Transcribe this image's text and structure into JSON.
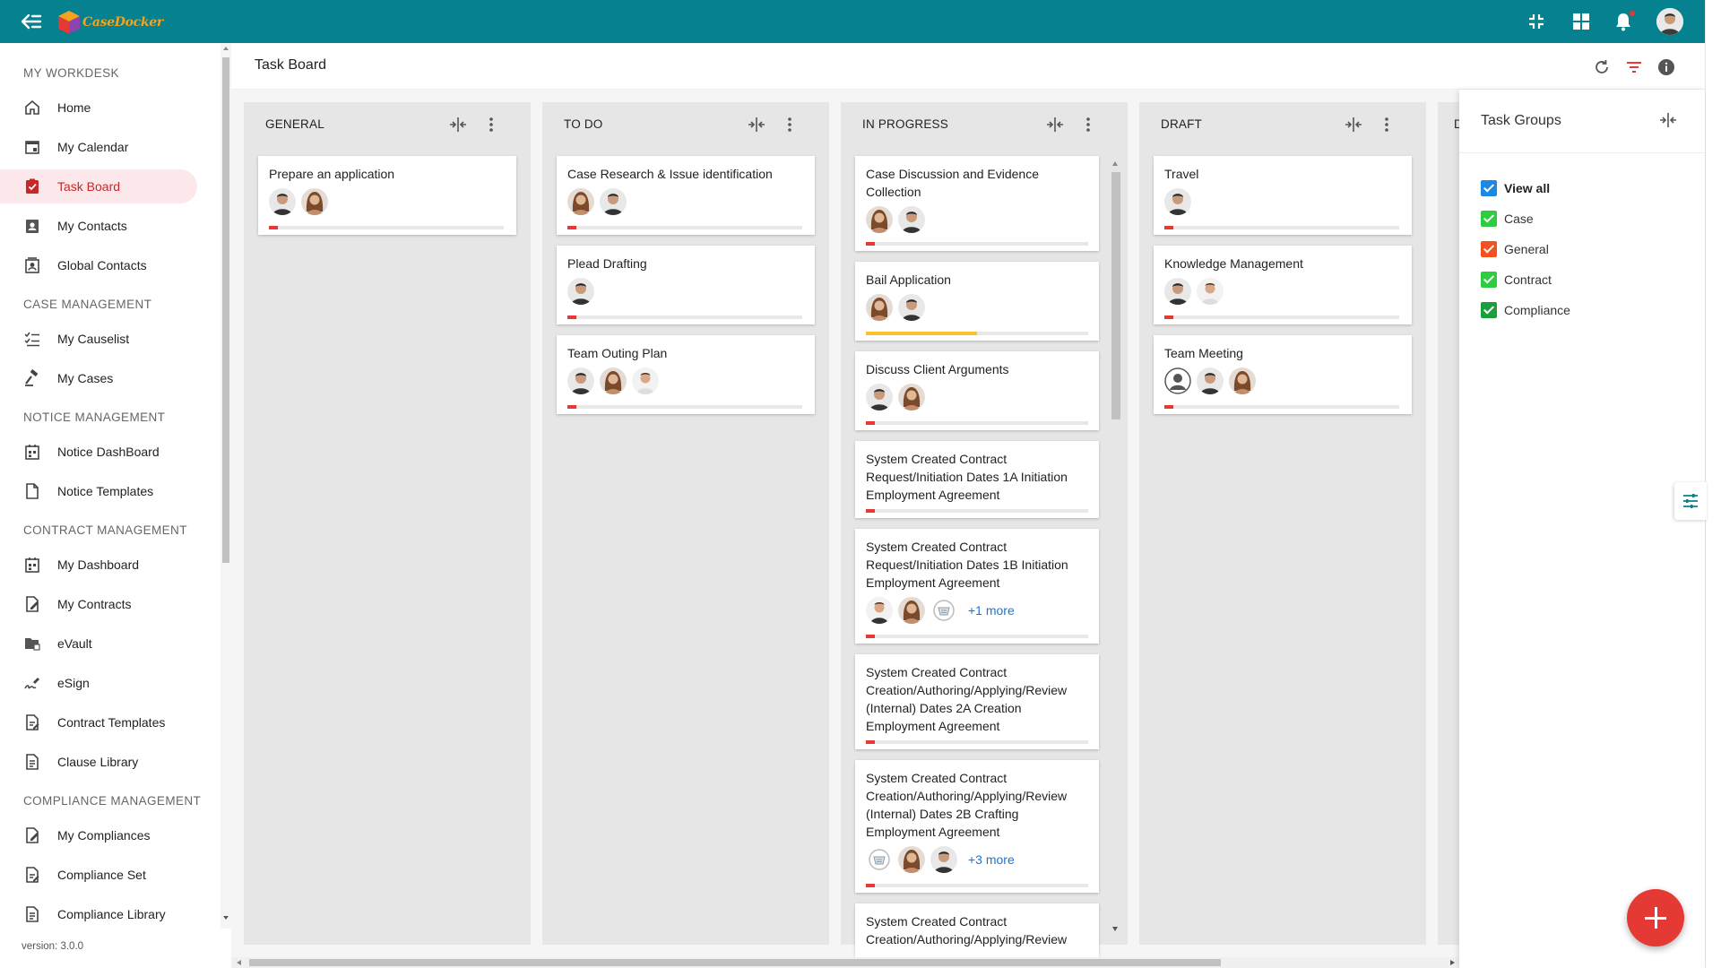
{
  "app": {
    "brand": "CaseDocker"
  },
  "sidebar": {
    "sections": [
      {
        "title": "MY WORKDESK",
        "items": [
          {
            "label": "Home",
            "icon": "home-icon"
          },
          {
            "label": "My Calendar",
            "icon": "calendar-icon"
          },
          {
            "label": "Task Board",
            "icon": "task-board-icon",
            "active": true
          },
          {
            "label": "My Contacts",
            "icon": "contact-card-icon"
          },
          {
            "label": "Global Contacts",
            "icon": "global-contacts-icon"
          }
        ]
      },
      {
        "title": "CASE MANAGEMENT",
        "items": [
          {
            "label": "My Causelist",
            "icon": "checklist-icon"
          },
          {
            "label": "My Cases",
            "icon": "gavel-icon"
          }
        ]
      },
      {
        "title": "NOTICE MANAGEMENT",
        "items": [
          {
            "label": "Notice DashBoard",
            "icon": "dashboard-icon"
          },
          {
            "label": "Notice Templates",
            "icon": "document-icon"
          }
        ]
      },
      {
        "title": "CONTRACT MANAGEMENT",
        "items": [
          {
            "label": "My Dashboard",
            "icon": "dashboard-icon"
          },
          {
            "label": "My Contracts",
            "icon": "contract-edit-icon"
          },
          {
            "label": "eVault",
            "icon": "folder-lock-icon"
          },
          {
            "label": "eSign",
            "icon": "signature-icon"
          },
          {
            "label": "Contract Templates",
            "icon": "template-icon"
          },
          {
            "label": "Clause Library",
            "icon": "library-icon"
          }
        ]
      },
      {
        "title": "COMPLIANCE MANAGEMENT",
        "items": [
          {
            "label": "My Compliances",
            "icon": "compliance-edit-icon"
          },
          {
            "label": "Compliance Set",
            "icon": "template-icon"
          },
          {
            "label": "Compliance Library",
            "icon": "library-icon"
          }
        ]
      }
    ],
    "version": "version: 3.0.0"
  },
  "header": {
    "title": "Task Board"
  },
  "colors": {
    "topbar": "#06818f",
    "progress_red": "#e53935",
    "progress_yellow": "#fbc02d",
    "checkbox_blue": "#1e88e5",
    "checkbox_green": "#2ecc40",
    "checkbox_orange": "#f4511e",
    "checkbox_darkgreen": "#1b9e3e"
  },
  "board": {
    "columns": [
      {
        "title": "GENERAL",
        "cards": [
          {
            "title": "Prepare an application",
            "avatars": [
              "man",
              "woman"
            ],
            "more": "",
            "progress": 0.04,
            "progress_color": "red"
          }
        ]
      },
      {
        "title": "TO DO",
        "cards": [
          {
            "title": "Case Research & Issue identification",
            "avatars": [
              "woman",
              "man"
            ],
            "more": "",
            "progress": 0.04,
            "progress_color": "red"
          },
          {
            "title": "Plead Drafting",
            "avatars": [
              "man"
            ],
            "more": "",
            "progress": 0.04,
            "progress_color": "red"
          },
          {
            "title": "Team Outing Plan",
            "avatars": [
              "man",
              "woman",
              "man2"
            ],
            "more": "",
            "progress": 0.04,
            "progress_color": "red"
          }
        ]
      },
      {
        "title": "IN PROGRESS",
        "cards": [
          {
            "title": "Case Discussion and Evidence Collection",
            "avatars": [
              "woman",
              "man"
            ],
            "more": "",
            "progress": 0.04,
            "progress_color": "red"
          },
          {
            "title": "Bail Application",
            "avatars": [
              "woman",
              "man"
            ],
            "more": "",
            "progress": 0.5,
            "progress_color": "yellow"
          },
          {
            "title": "Discuss Client Arguments",
            "avatars": [
              "man",
              "woman"
            ],
            "more": "",
            "progress": 0.04,
            "progress_color": "red"
          },
          {
            "title": "System Created Contract Request/Initiation Dates 1A Initiation Employment Agreement",
            "avatars": [],
            "more": "",
            "progress": 0.04,
            "progress_color": "red"
          },
          {
            "title": "System Created Contract Request/Initiation Dates 1B Initiation Employment Agreement",
            "avatars": [
              "man2",
              "woman",
              "badge"
            ],
            "more": "+1 more",
            "progress": 0.04,
            "progress_color": "red"
          },
          {
            "title": "System Created Contract Creation/Authoring/Applying/Review (Internal) Dates 2A Creation Employment Agreement",
            "avatars": [],
            "more": "",
            "progress": 0.04,
            "progress_color": "red"
          },
          {
            "title": "System Created Contract Creation/Authoring/Applying/Review (Internal) Dates 2B Crafting Employment Agreement",
            "avatars": [
              "badge",
              "woman",
              "man"
            ],
            "more": "+3 more",
            "progress": 0.04,
            "progress_color": "red"
          },
          {
            "title": "System Created Contract Creation/Authoring/Applying/Review",
            "avatars": [],
            "more": "",
            "progress": 0,
            "progress_color": "red"
          }
        ]
      },
      {
        "title": "DRAFT",
        "cards": [
          {
            "title": "Travel",
            "avatars": [
              "man"
            ],
            "more": "",
            "progress": 0.04,
            "progress_color": "red"
          },
          {
            "title": "Knowledge Management",
            "avatars": [
              "man",
              "man2"
            ],
            "more": "",
            "progress": 0.04,
            "progress_color": "red"
          },
          {
            "title": "Team Meeting",
            "avatars": [
              "placeholder",
              "man",
              "woman"
            ],
            "more": "",
            "progress": 0.04,
            "progress_color": "red"
          }
        ]
      }
    ],
    "partial_column_initial": "D"
  },
  "task_groups": {
    "title": "Task Groups",
    "items": [
      {
        "label": "View all",
        "color": "#1e88e5",
        "bold": true
      },
      {
        "label": "Case",
        "color": "#2ecc40",
        "bold": false
      },
      {
        "label": "General",
        "color": "#f4511e",
        "bold": false
      },
      {
        "label": "Contract",
        "color": "#2ecc40",
        "bold": false
      },
      {
        "label": "Compliance",
        "color": "#1b9e3e",
        "bold": false
      }
    ]
  }
}
